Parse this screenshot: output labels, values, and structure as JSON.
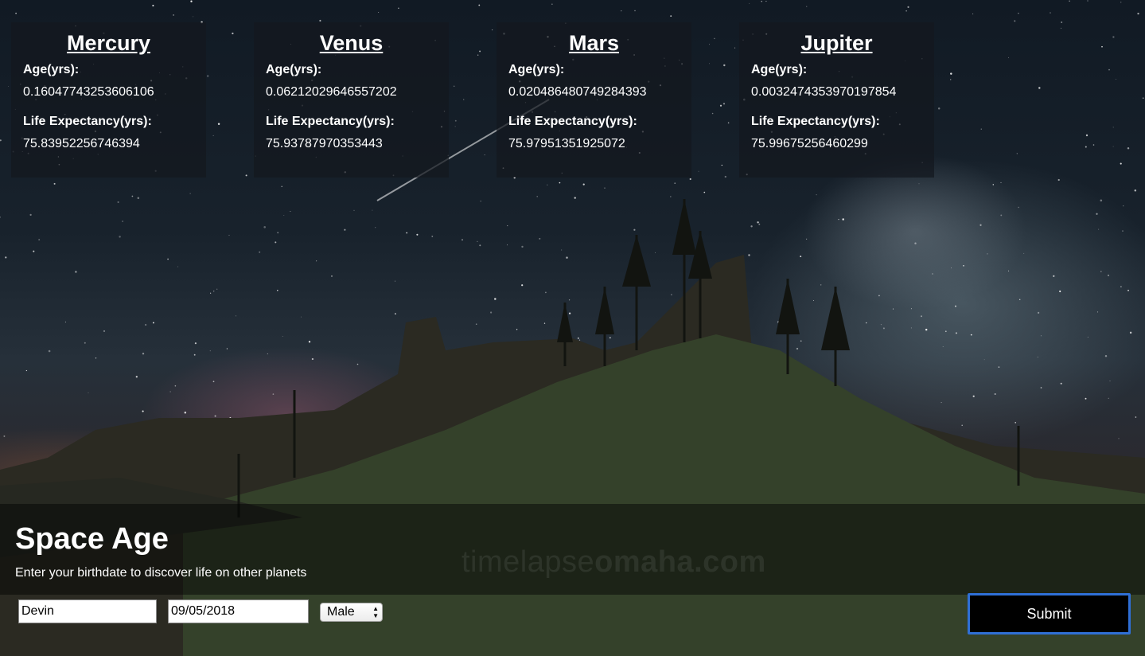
{
  "planets": [
    {
      "name": "Mercury",
      "age_label": "Age(yrs):",
      "age": "0.16047743253606106",
      "life_label": "Life Expectancy(yrs):",
      "life": "75.83952256746394"
    },
    {
      "name": "Venus",
      "age_label": "Age(yrs):",
      "age": "0.06212029646557202",
      "life_label": "Life Expectancy(yrs):",
      "life": "75.93787970353443"
    },
    {
      "name": "Mars",
      "age_label": "Age(yrs):",
      "age": "0.020486480749284393",
      "life_label": "Life Expectancy(yrs):",
      "life": "75.97951351925072"
    },
    {
      "name": "Jupiter",
      "age_label": "Age(yrs):",
      "age": "0.0032474353970197854",
      "life_label": "Life Expectancy(yrs):",
      "life": "75.99675256460299"
    }
  ],
  "header": {
    "title": "Space Age",
    "subtitle": "Enter your birthdate to discover life on other planets"
  },
  "watermark": {
    "light": "timelapse",
    "bold": "omaha.com"
  },
  "form": {
    "name_value": "Devin",
    "date_value": "09/05/2018",
    "gender_selected": "Male",
    "submit_label": "Submit"
  },
  "colors": {
    "submit_border": "#2f6fd6",
    "submit_background": "#000000"
  }
}
